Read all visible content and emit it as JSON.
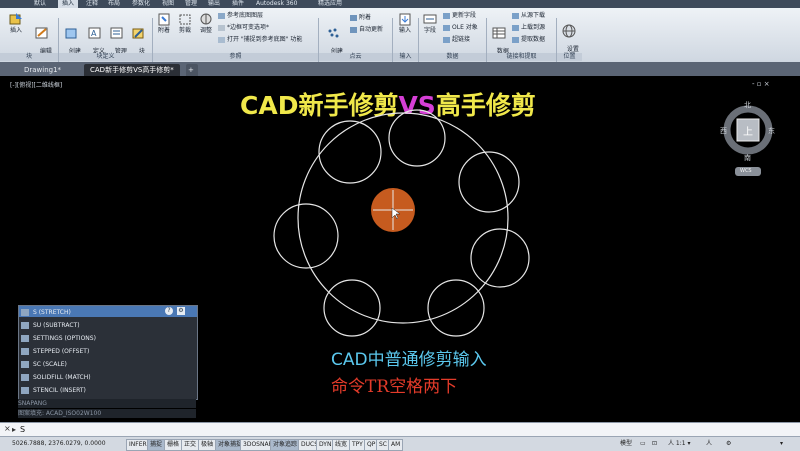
{
  "ribbon": {
    "tabs": [
      "默认",
      "插入",
      "注释",
      "布局",
      "参数化",
      "视图",
      "管理",
      "输出",
      "插件",
      "Autodesk 360",
      "精选应用"
    ],
    "active_tab": "插入",
    "buttons": {
      "insert": "插入",
      "edit_attr": "编辑\n属性",
      "create_block": "创建\n块",
      "define_attr": "定义\n属性",
      "manage_attr": "管理\n属性",
      "block_editor": "块\n编辑器",
      "attach": "附着",
      "clip": "剪裁",
      "adjust": "调整",
      "underlay_layers": "参考底图图层",
      "frame_variable": "*边框可变选项*",
      "snap_underlay": "打开 \"捕捉到参考底图\" 功能",
      "create_pointcloud": "创建\n点云",
      "attach2": "附着",
      "auto_update": "自动更新",
      "import": "输入",
      "field": "字段",
      "update_fields": "更新字段",
      "ole_object": "OLE 对象",
      "hyperlink": "超链接",
      "data_link": "数据\n链接",
      "download_source": "从源下载",
      "upload_source": "上载到源",
      "extract_data": "提取数据",
      "set_location": "设置\n位置"
    },
    "panels": [
      "块",
      "块定义",
      "参照",
      "点云",
      "输入",
      "数据",
      "链接和提取",
      "位置"
    ]
  },
  "doc_tabs": [
    "Drawing1*",
    "CAD新手修剪VS高手修剪*"
  ],
  "active_doc_tab": 1,
  "viewport_label": "[-][俯视][二维线框]",
  "window_controls": "- ▫ ×",
  "title": {
    "part1": "CAD新手修剪",
    "part2": "VS",
    "part3": "高手修剪"
  },
  "viewcube": {
    "north": "北",
    "south": "南",
    "east": "东",
    "west": "西",
    "top": "上",
    "wcs": "WCS"
  },
  "autocomplete": {
    "items": [
      "S (STRETCH)",
      "SU (SUBTRACT)",
      "SETTINGS (OPTIONS)",
      "STEPPED (OFFSET)",
      "SC (SCALE)",
      "SOLIDFILL (MATCH)",
      "STENCIL (INSERT)"
    ],
    "dim_rows": [
      "SNAPANG",
      "图案填充: ACAD_ISO02W100"
    ]
  },
  "notes": {
    "line1": "CAD中普通修剪输入",
    "line2": "命令TR空格两下"
  },
  "command_line": {
    "prefix": "▸",
    "value": "S"
  },
  "status": {
    "coords": "5026.7888, 2376.0279, 0.0000",
    "toggles": [
      "INFER",
      "捕捉",
      "栅格",
      "正交",
      "极轴",
      "对象捕捉",
      "3DOSNAP",
      "对象追踪",
      "DUCS",
      "DYN",
      "线宽",
      "TPY",
      "QP",
      "SC",
      "AM"
    ],
    "right": [
      "模型",
      "▭",
      "⊡",
      "人 1:1 ▾",
      "人",
      "⚙",
      "▾"
    ]
  },
  "colors": {
    "title_yellow": "#f0e84a",
    "title_magenta": "#d63fd6",
    "circle_line": "#e6e6e6",
    "orange_fill": "#c65b1f"
  }
}
